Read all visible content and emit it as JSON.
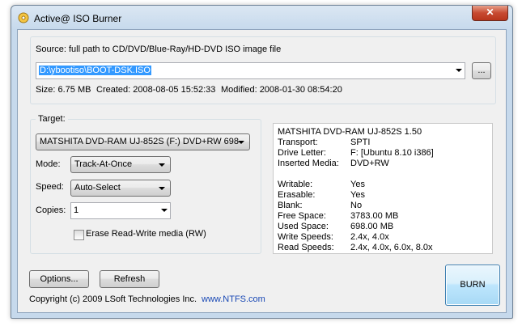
{
  "window": {
    "title": "Active@ ISO Burner",
    "close_label": "✕"
  },
  "source": {
    "label": "Source: full path to CD/DVD/Blue-Ray/HD-DVD ISO image file",
    "path": "D:\\ybootiso\\BOOT-DSK.ISO",
    "browse_label": "...",
    "size_label": "Size: 6.75 MB",
    "created_label": "Created: 2008-08-05 15:52:33",
    "modified_label": "Modified: 2008-01-30 08:54:20"
  },
  "target": {
    "group_label": "Target:",
    "device": "MATSHITA DVD-RAM UJ-852S  (F:)  DVD+RW 698",
    "mode_label": "Mode:",
    "mode_value": "Track-At-Once",
    "speed_label": "Speed:",
    "speed_value": "Auto-Select",
    "copies_label": "Copies:",
    "copies_value": "1",
    "erase_label": "Erase Read-Write media (RW)",
    "erase_checked": false
  },
  "info": {
    "header": "MATSHITA DVD-RAM UJ-852S  1.50",
    "rows1": [
      {
        "key": "Transport:",
        "value": "SPTI"
      },
      {
        "key": "Drive Letter:",
        "value": "F:   [Ubuntu 8.10 i386]"
      },
      {
        "key": "Inserted Media:",
        "value": "DVD+RW"
      }
    ],
    "rows2": [
      {
        "key": "Writable:",
        "value": "Yes"
      },
      {
        "key": "Erasable:",
        "value": "Yes"
      },
      {
        "key": "Blank:",
        "value": "No"
      },
      {
        "key": "Free Space:",
        "value": "3783.00 MB"
      },
      {
        "key": "Used Space:",
        "value": "698.00 MB"
      },
      {
        "key": "Write Speeds:",
        "value": "2.4x, 4.0x"
      },
      {
        "key": "Read Speeds:",
        "value": "2.4x, 4.0x, 6.0x, 8.0x"
      }
    ]
  },
  "buttons": {
    "options": "Options...",
    "refresh": "Refresh",
    "burn": "BURN"
  },
  "footer": {
    "copyright": "Copyright (c) 2009 LSoft Technologies Inc.",
    "link": "www.NTFS.com"
  }
}
